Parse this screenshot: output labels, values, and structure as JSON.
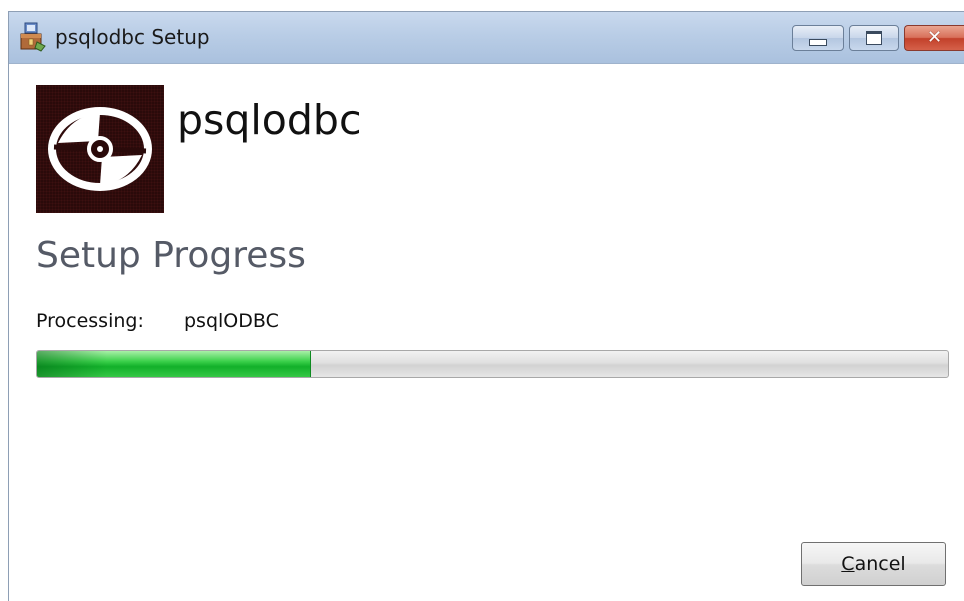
{
  "window": {
    "title": "psqlodbc Setup",
    "icon": "installer-icon",
    "controls": {
      "minimize_icon": "minimize-icon",
      "maximize_icon": "maximize-icon",
      "close_glyph": "✕"
    }
  },
  "header": {
    "logo_icon": "disc-icon",
    "app_name": "psqlodbc"
  },
  "main": {
    "heading": "Setup Progress",
    "status_label": "Processing:",
    "status_value": "psqlODBC",
    "progress_fraction": 0.3
  },
  "footer": {
    "cancel_label_accel": "C",
    "cancel_label_rest": "ancel"
  },
  "colors": {
    "progress_green": "#22c23a",
    "titlebar_blue": "#b9cde6",
    "logo_background": "#2a0a0a",
    "close_red": "#c2402a"
  }
}
